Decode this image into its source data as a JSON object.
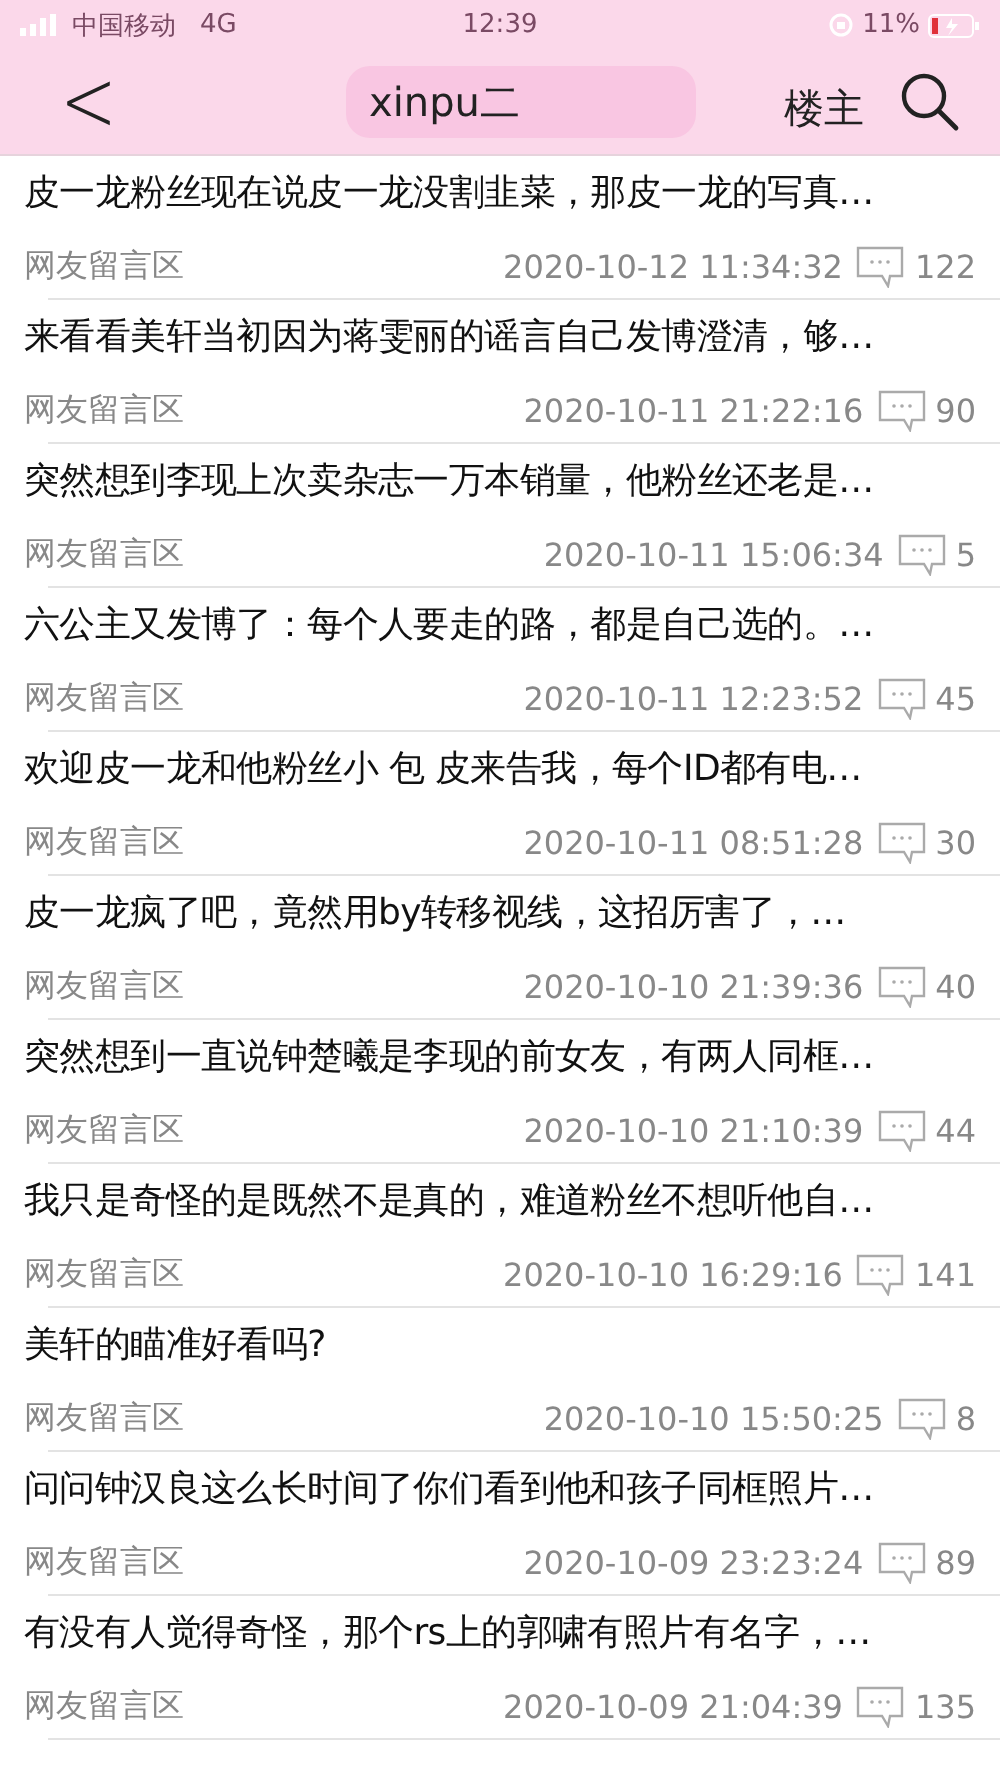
{
  "status_bar": {
    "carrier": "中国移动",
    "network": "4G",
    "time": "12:39",
    "battery": "11%"
  },
  "nav": {
    "back": "<",
    "title": "xinpu二",
    "owner_filter": "楼主"
  },
  "posts": [
    {
      "title": "皮一龙粉丝现在说皮一龙没割韭菜，那皮一龙的写真…",
      "board": "网友留言区",
      "time": "2020-10-12 11:34:32",
      "replies": "122"
    },
    {
      "title": "来看看美轩当初因为蒋雯丽的谣言自己发博澄清，够…",
      "board": "网友留言区",
      "time": "2020-10-11 21:22:16",
      "replies": "90"
    },
    {
      "title": "突然想到李现上次卖杂志一万本销量，他粉丝还老是…",
      "board": "网友留言区",
      "time": "2020-10-11 15:06:34",
      "replies": "5"
    },
    {
      "title": "六公主又发博了：每个人要走的路，都是自己选的。…",
      "board": "网友留言区",
      "time": "2020-10-11 12:23:52",
      "replies": "45"
    },
    {
      "title": "欢迎皮一龙和他粉丝小 包 皮来告我，每个ID都有电…",
      "board": "网友留言区",
      "time": "2020-10-11 08:51:28",
      "replies": "30"
    },
    {
      "title": "皮一龙疯了吧，竟然用by转移视线，这招厉害了，…",
      "board": "网友留言区",
      "time": "2020-10-10 21:39:36",
      "replies": "40"
    },
    {
      "title": "突然想到一直说钟楚曦是李现的前女友，有两人同框…",
      "board": "网友留言区",
      "time": "2020-10-10 21:10:39",
      "replies": "44"
    },
    {
      "title": "我只是奇怪的是既然不是真的，难道粉丝不想听他自…",
      "board": "网友留言区",
      "time": "2020-10-10 16:29:16",
      "replies": "141"
    },
    {
      "title": "美轩的瞄准好看吗?",
      "board": "网友留言区",
      "time": "2020-10-10 15:50:25",
      "replies": "8"
    },
    {
      "title": "问问钟汉良这么长时间了你们看到他和孩子同框照片…",
      "board": "网友留言区",
      "time": "2020-10-09 23:23:24",
      "replies": "89"
    },
    {
      "title": "有没有人觉得奇怪，那个rs上的郭啸有照片有名字，…",
      "board": "网友留言区",
      "time": "2020-10-09 21:04:39",
      "replies": "135"
    }
  ]
}
